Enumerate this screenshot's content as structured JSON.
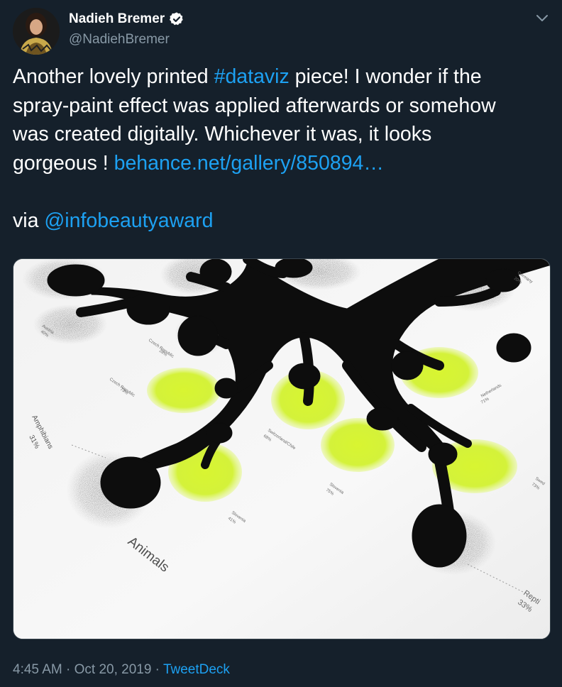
{
  "author": {
    "display_name": "Nadieh Bremer",
    "handle": "@NadiehBremer"
  },
  "tweet": {
    "line1_before": "Another lovely printed ",
    "hashtag": "#dataviz",
    "line1_after": " piece! I wonder if the",
    "line2": "spray-paint effect was applied afterwards or somehow",
    "line3": "was created digitally. Whichever it was, it looks",
    "line4_before": "gorgeous  ! ",
    "link": "behance.net/gallery/850894…",
    "via_prefix": "via ",
    "mention": "@infobeautyaward"
  },
  "media": {
    "labels": {
      "austria": "Austria",
      "austria_pct": "40%",
      "czech1": "Czech Republic",
      "czech1_pct": "28%",
      "czech2": "Czech Republic",
      "czech2_pct": "73%",
      "amphibians": "Amphibians",
      "amphibians_pct": "31%",
      "switzerland": "Switzerland/Chile",
      "switzerland_pct": "68%",
      "slovenia1": "Slovenia",
      "slovenia1_pct": "75%",
      "slovenia2": "Slovenia",
      "slovenia2_pct": "41%",
      "animals": "Animals",
      "germany": "Germany",
      "germany_pct": "20%",
      "netherlands": "Netherlands",
      "netherlands_pct": "71%",
      "sweden": "Swed",
      "sweden_pct": "73%",
      "reptiles": "Repti",
      "reptiles_pct": "33%"
    }
  },
  "meta": {
    "time": "4:45 AM",
    "sep1": " · ",
    "date": "Oct 20, 2019",
    "sep2": " · ",
    "client": "TweetDeck"
  },
  "colors": {
    "background": "#15202b",
    "link": "#1da1f2",
    "secondary_text": "#8899a6",
    "lime": "#d4f23a"
  }
}
